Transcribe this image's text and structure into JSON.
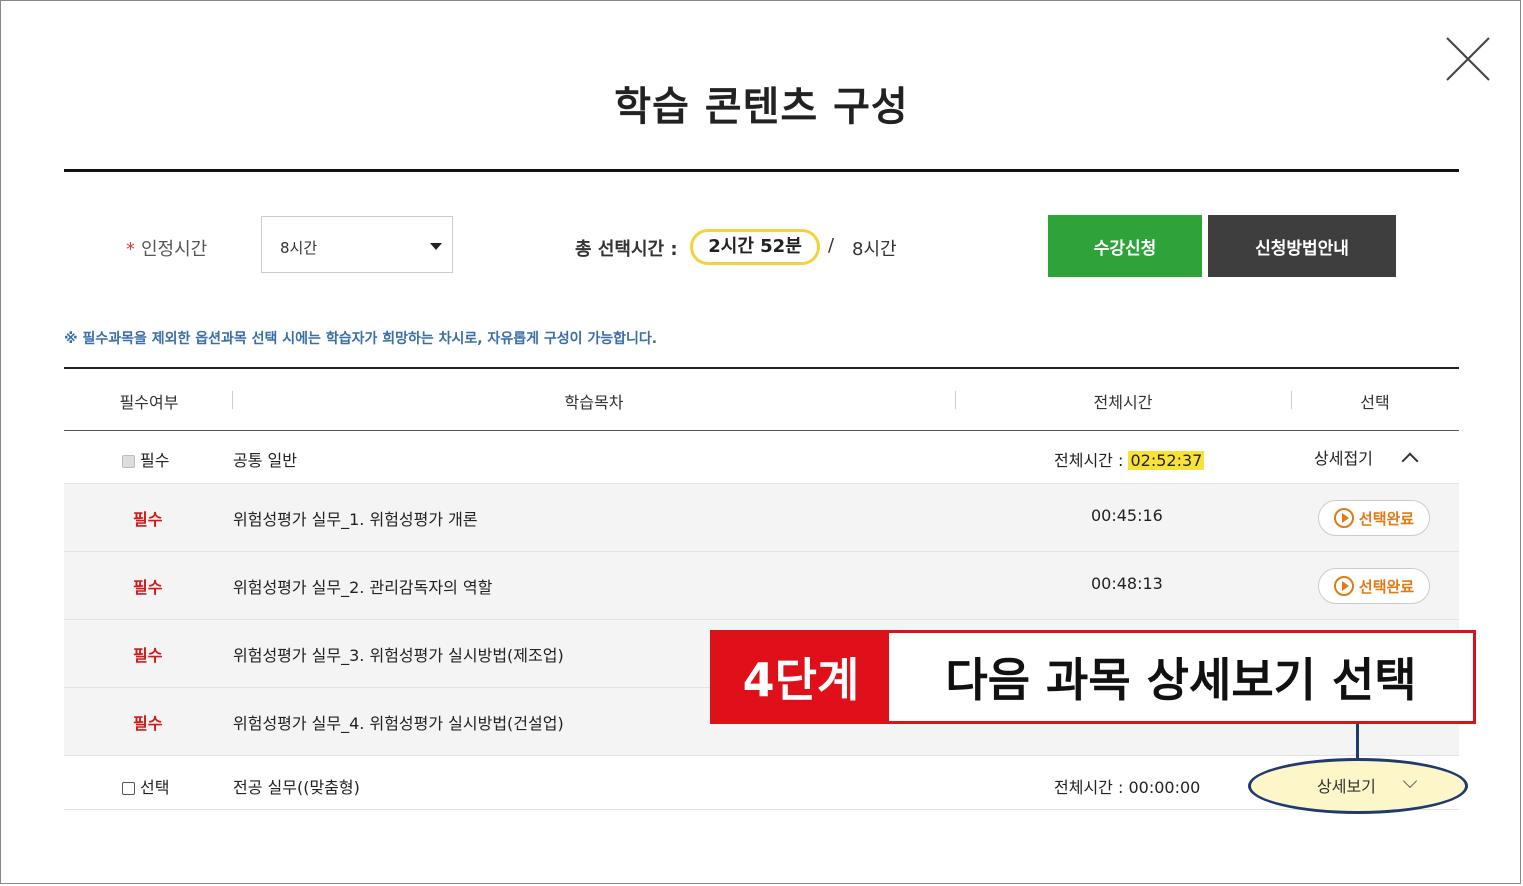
{
  "dialog": {
    "title": "학습 콘텐츠 구성",
    "close_icon": "close-icon"
  },
  "controls": {
    "cert_time_label": "인정시간",
    "required_star": "*",
    "cert_time_value": "8시간",
    "total_label": "총 선택시간 :",
    "total_value": "2시간 52분",
    "slash": "/",
    "total_max": "8시간",
    "apply_button": "수강신청",
    "guide_button": "신청방법안내"
  },
  "notice": "※ 필수과목을 제외한 옵션과목 선택 시에는 학습자가 희망하는 차시로, 자유롭게 구성이 가능합니다.",
  "table": {
    "headers": [
      "필수여부",
      "학습목차",
      "전체시간",
      "선택"
    ],
    "group1": {
      "type": "필수",
      "name": "공통 일반",
      "time_label": "전체시간 :",
      "time_value": "02:52:37",
      "toggle_label": "상세접기"
    },
    "lessons": [
      {
        "req": "필수",
        "title": "위험성평가 실무_1. 위험성평가 개론",
        "time": "00:45:16",
        "action": "선택완료"
      },
      {
        "req": "필수",
        "title": "위험성평가 실무_2. 관리감독자의 역할",
        "time": "00:48:13",
        "action": "선택완료"
      },
      {
        "req": "필수",
        "title": "위험성평가 실무_3. 위험성평가 실시방법(제조업)",
        "time": "",
        "action": ""
      },
      {
        "req": "필수",
        "title": "위험성평가 실무_4. 위험성평가 실시방법(건설업)",
        "time": "",
        "action": ""
      }
    ],
    "group2": {
      "type": "선택",
      "name": "전공 실무((맞춤형)",
      "time_label": "전체시간 :",
      "time_value": "00:00:00",
      "toggle_label": "상세보기"
    }
  },
  "annotation": {
    "step": "4단계",
    "message": "다음 과목 상세보기 선택",
    "color_box": "#e0101a",
    "color_marker": "#1f3a6e"
  }
}
